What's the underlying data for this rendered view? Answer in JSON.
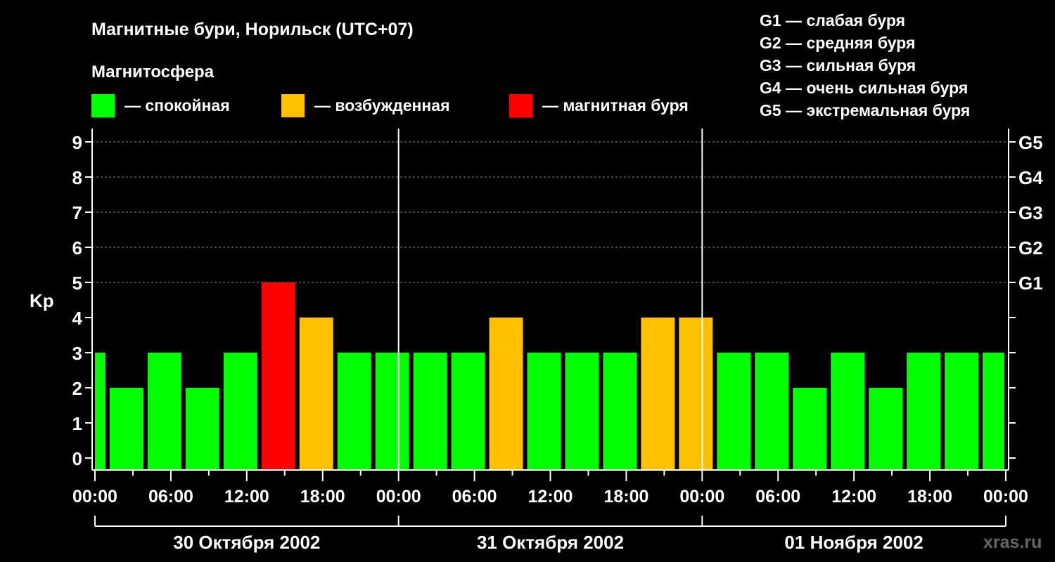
{
  "chart_data": {
    "type": "bar",
    "title": "Магнитные бури, Норильск (UTC+07)",
    "legend_title": "Магнитосфера",
    "legend": [
      {
        "label": "— спокойная",
        "color": "#00ff00"
      },
      {
        "label": "— возбужденная",
        "color": "#ffc000"
      },
      {
        "label": "— магнитная буря",
        "color": "#ff0000"
      }
    ],
    "g_legend": [
      "G1 — слабая буря",
      "G2 — средняя буря",
      "G3 — сильная буря",
      "G4 — очень сильная буря",
      "G5 — экстремальная буря"
    ],
    "ylabel": "Kp",
    "ylim": [
      0,
      9
    ],
    "yticks": [
      "0",
      "1",
      "2",
      "3",
      "4",
      "5",
      "6",
      "7",
      "8",
      "9"
    ],
    "right_ticks": [
      {
        "v": 5,
        "label": "G1"
      },
      {
        "v": 6,
        "label": "G2"
      },
      {
        "v": 7,
        "label": "G3"
      },
      {
        "v": 8,
        "label": "G4"
      },
      {
        "v": 9,
        "label": "G5"
      }
    ],
    "xlim_hours": [
      0,
      72
    ],
    "xtick_labels": [
      "00:00",
      "06:00",
      "12:00",
      "18:00",
      "00:00",
      "06:00",
      "12:00",
      "18:00",
      "00:00",
      "06:00",
      "12:00",
      "18:00",
      "00:00"
    ],
    "days": [
      "30 Октября 2002",
      "31 Октября 2002",
      "01 Ноября 2002"
    ],
    "bars": [
      {
        "start": 0,
        "end": 1,
        "kp": 3
      },
      {
        "start": 1,
        "end": 4,
        "kp": 2
      },
      {
        "start": 4,
        "end": 7,
        "kp": 3
      },
      {
        "start": 7,
        "end": 10,
        "kp": 2
      },
      {
        "start": 10,
        "end": 13,
        "kp": 3
      },
      {
        "start": 13,
        "end": 16,
        "kp": 5
      },
      {
        "start": 16,
        "end": 19,
        "kp": 4
      },
      {
        "start": 19,
        "end": 22,
        "kp": 3
      },
      {
        "start": 22,
        "end": 25,
        "kp": 3
      },
      {
        "start": 25,
        "end": 28,
        "kp": 3
      },
      {
        "start": 28,
        "end": 31,
        "kp": 3
      },
      {
        "start": 31,
        "end": 34,
        "kp": 4
      },
      {
        "start": 34,
        "end": 37,
        "kp": 3
      },
      {
        "start": 37,
        "end": 40,
        "kp": 3
      },
      {
        "start": 40,
        "end": 43,
        "kp": 3
      },
      {
        "start": 43,
        "end": 46,
        "kp": 4
      },
      {
        "start": 46,
        "end": 49,
        "kp": 4
      },
      {
        "start": 49,
        "end": 52,
        "kp": 3
      },
      {
        "start": 52,
        "end": 55,
        "kp": 3
      },
      {
        "start": 55,
        "end": 58,
        "kp": 2
      },
      {
        "start": 58,
        "end": 61,
        "kp": 3
      },
      {
        "start": 61,
        "end": 64,
        "kp": 2
      },
      {
        "start": 64,
        "end": 67,
        "kp": 3
      },
      {
        "start": 67,
        "end": 70,
        "kp": 3
      },
      {
        "start": 70,
        "end": 72,
        "kp": 3
      }
    ],
    "colors": {
      "quiet": "#00ff00",
      "excited": "#ffc000",
      "storm": "#ff0000"
    },
    "watermark": "xras.ru"
  }
}
